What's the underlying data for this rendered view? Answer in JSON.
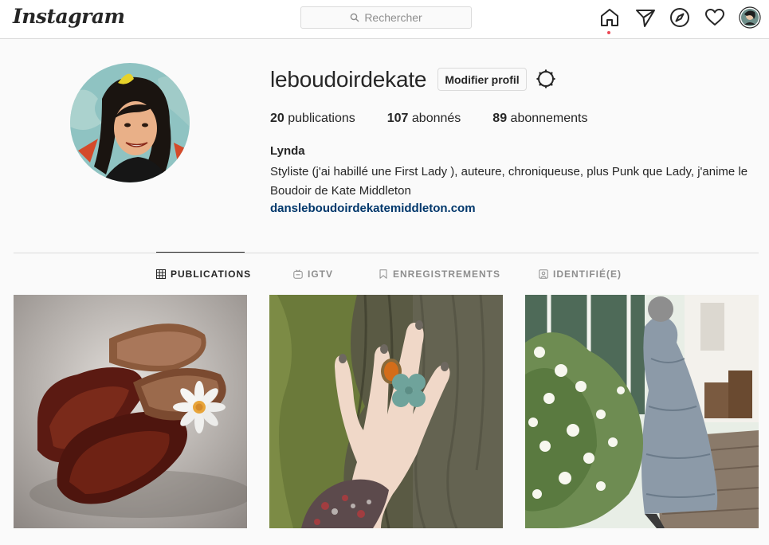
{
  "header": {
    "logo": "Instagram",
    "search_placeholder": "Rechercher",
    "icons": [
      "home-icon",
      "direct-icon",
      "explore-icon",
      "activity-icon",
      "profile-avatar"
    ]
  },
  "profile": {
    "username": "leboudoirdekate",
    "edit_label": "Modifier profil",
    "stats": {
      "posts_count": "20",
      "posts_label": " publications",
      "followers_count": "107",
      "followers_label": " abonnés",
      "following_count": "89",
      "following_label": " abonnements"
    },
    "name": "Lynda",
    "bio": "Styliste (j'ai habillé une First Lady ), auteure, chroniqueuse, plus Punk que Lady, j'anime le Boudoir de Kate Middleton",
    "link": "dansleboudoirdekatemiddleton.com"
  },
  "tabs": [
    {
      "label": "PUBLICATIONS",
      "icon": "grid-icon",
      "active": true
    },
    {
      "label": "IGTV",
      "icon": "igtv-icon",
      "active": false
    },
    {
      "label": "ENREGISTREMENTS",
      "icon": "bookmark-icon",
      "active": false
    },
    {
      "label": "IDENTIFIÉ(E)",
      "icon": "tagged-icon",
      "active": false
    }
  ],
  "posts": [
    {
      "subject": "red clogs with daisy"
    },
    {
      "subject": "hand with rings on tree bark"
    },
    {
      "subject": "woman in dress in garden"
    }
  ]
}
